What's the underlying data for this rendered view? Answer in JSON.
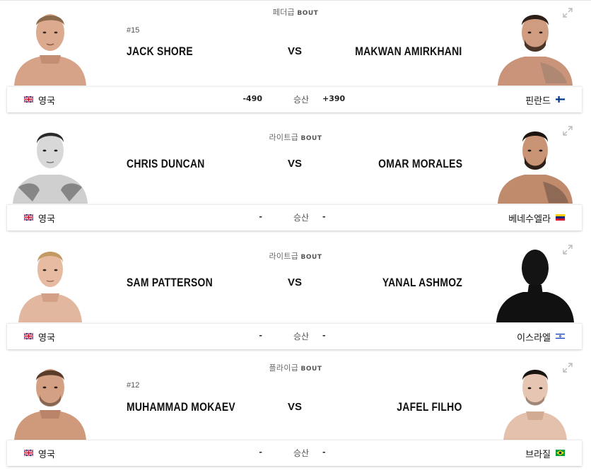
{
  "bouts": [
    {
      "weight_class": "페더급",
      "bout_label": "BOUT",
      "rank_left": "#15",
      "fighter_left": "JACK SHORE",
      "vs": "VS",
      "fighter_right": "MAKWAN AMIRKHANI",
      "country_left": "영국",
      "odds_left": "-490",
      "win_label": "승산",
      "odds_right": "+390",
      "country_right": "핀란드",
      "flag_left": "uk-flag-icon",
      "flag_right": "finland-flag-icon"
    },
    {
      "weight_class": "라이트급",
      "bout_label": "BOUT",
      "fighter_left": "CHRIS DUNCAN",
      "vs": "VS",
      "fighter_right": "OMAR MORALES",
      "country_left": "영국",
      "odds_left": "-",
      "win_label": "승산",
      "odds_right": "-",
      "country_right": "베네수엘라",
      "flag_left": "uk-flag-icon",
      "flag_right": "venezuela-flag-icon"
    },
    {
      "weight_class": "라이트급",
      "bout_label": "BOUT",
      "fighter_left": "SAM PATTERSON",
      "vs": "VS",
      "fighter_right": "YANAL ASHMOZ",
      "country_left": "영국",
      "odds_left": "-",
      "win_label": "승산",
      "odds_right": "-",
      "country_right": "이스라엘",
      "flag_left": "uk-flag-icon",
      "flag_right": "israel-flag-icon"
    },
    {
      "weight_class": "플라이급",
      "bout_label": "BOUT",
      "rank_left": "#12",
      "fighter_left": "MUHAMMAD MOKAEV",
      "vs": "VS",
      "fighter_right": "JAFEL FILHO",
      "country_left": "영국",
      "odds_left": "-",
      "win_label": "승산",
      "odds_right": "-",
      "country_right": "브라질",
      "flag_left": "uk-flag-icon",
      "flag_right": "brazil-flag-icon"
    }
  ],
  "colors": {
    "skin": "#d9a58a",
    "skin_shade": "#b97e63",
    "hair": "#3a2a20",
    "silhouette": "#111111",
    "text": "#111111",
    "muted": "#666666"
  }
}
